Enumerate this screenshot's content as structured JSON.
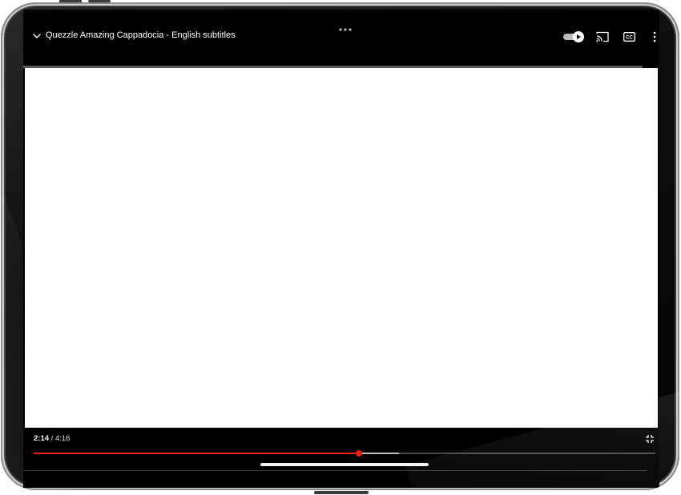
{
  "player": {
    "title": "Quezzle Amazing Cappadocia - English subtitles",
    "current_time": "2:14",
    "time_separator": " / ",
    "duration": "4:16",
    "progress_fraction": 0.523,
    "buffered_fraction": 0.588,
    "icons": {
      "collapse": "chevron-down-icon",
      "drag": "more-horizontal-icon",
      "autoplay": "autoplay-toggle-icon",
      "cast": "cast-icon",
      "captions": "closed-captions-icon",
      "more": "more-vertical-icon",
      "exit_fullscreen": "exit-fullscreen-icon"
    },
    "colors": {
      "accent": "#e62117",
      "screen_background": "#000000",
      "video_area": "#ffffff",
      "text": "#ffffff"
    },
    "captions_label": "CC"
  }
}
